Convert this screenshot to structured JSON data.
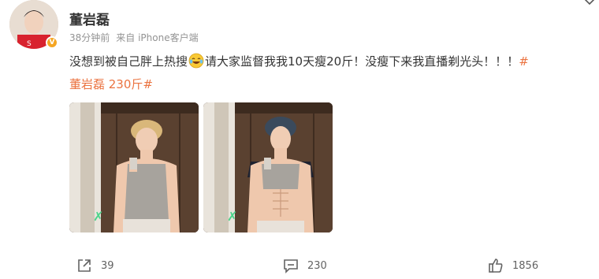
{
  "post": {
    "author": "董岩磊",
    "verified_badge": "V",
    "time": "38分钟前",
    "source": "来自 iPhone客户端",
    "text_part1": "没想到被自己胖上热搜",
    "text_part2": "请大家监督我我10天瘦20斤！没瘦下来我直播剃光头！！！",
    "hashtag_start": "#",
    "hashtag_line2": "董岩磊 230斤#",
    "emoji": "laugh-cry-emoji",
    "images": [
      {
        "name": "mirror-selfie-before"
      },
      {
        "name": "mirror-selfie-after"
      }
    ]
  },
  "actions": {
    "share_count": "39",
    "comment_count": "230",
    "like_count": "1856"
  },
  "colors": {
    "hashtag": "#eb7340",
    "meta": "#939393",
    "badge": "#f5a623"
  }
}
